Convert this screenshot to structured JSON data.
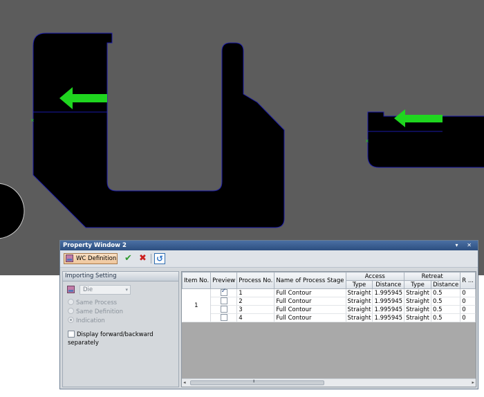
{
  "colors": {
    "canvas_bg": "#5c5c5c",
    "part_fill": "#000000",
    "outline": "#1a1aa8",
    "arrow": "#1fd61f",
    "toolbar_btn": "#efc69c"
  },
  "window": {
    "title": "Property Window 2",
    "title_buttons": "▾ ✕"
  },
  "toolbar": {
    "wc_label": "WC Definition",
    "ok_icon": "✔",
    "cancel_icon": "✖",
    "refresh_icon": "↺"
  },
  "importing": {
    "header": "Importing Setting",
    "die_value": "Die",
    "die_arrow": "▾",
    "options": [
      "Same Process",
      "Same Definition",
      "Indication"
    ],
    "selected_option": "Indication",
    "separate_label": "Display forward/backward separately"
  },
  "grid": {
    "headers": {
      "item_no": "Item No.",
      "preview": "Preview",
      "process_no": "Process No.",
      "stage": "Name of Process Stage",
      "access": "Access",
      "retreat": "Retreat",
      "r": "R ..."
    },
    "sub_headers": {
      "access_type": "Type",
      "access_distance": "Distance",
      "retreat_type": "Type",
      "retreat_distance": "Distance"
    },
    "item_no": "1",
    "rows": [
      {
        "checked": true,
        "process_no": "1",
        "stage": "Full Contour",
        "access_type": "Straight",
        "access_distance": "1.995945",
        "retreat_type": "Straight",
        "retreat_distance": "0.5",
        "r": "0"
      },
      {
        "checked": false,
        "process_no": "2",
        "stage": "Full Contour",
        "access_type": "Straight",
        "access_distance": "1.995945",
        "retreat_type": "Straight",
        "retreat_distance": "0.5",
        "r": "0"
      },
      {
        "checked": false,
        "process_no": "3",
        "stage": "Full Contour",
        "access_type": "Straight",
        "access_distance": "1.995945",
        "retreat_type": "Straight",
        "retreat_distance": "0.5",
        "r": "0"
      },
      {
        "checked": false,
        "process_no": "4",
        "stage": "Full Contour",
        "access_type": "Straight",
        "access_distance": "1.995945",
        "retreat_type": "Straight",
        "retreat_distance": "0.5",
        "r": "0"
      }
    ]
  },
  "scrollbar": {
    "left_arrow": "◂",
    "right_arrow": "▸"
  }
}
